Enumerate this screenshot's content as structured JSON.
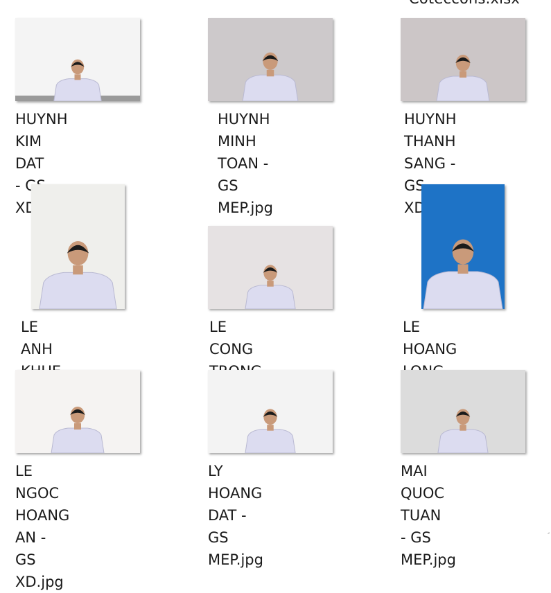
{
  "partial_item": {
    "label": "Coteccons.xlsx"
  },
  "files": [
    {
      "name": "HUYNH KIM DAT\n- GS XD.jpg",
      "photo": {
        "bg": "#f4f4f4",
        "scale": 0.9
      }
    },
    {
      "name": "HUYNH MINH\nTOAN - GS\nMEP.jpg",
      "photo": {
        "bg": "#cdc9cb",
        "scale": 1.05
      }
    },
    {
      "name": "HUYNH THANH\nSANG - GS\nXD.jpg",
      "photo": {
        "bg": "#ccc6c7",
        "scale": 1.0
      }
    },
    {
      "name": "LE ANH KHUE -\nGS XD.jpg",
      "photo": {
        "bg": "#efefec",
        "scale": 1.3
      }
    },
    {
      "name": "LE CONG TRONG\n- GS XD.jpg",
      "photo": {
        "bg": "#e6e2e3",
        "scale": 0.95
      }
    },
    {
      "name": "LE HOANG LONG\n- GS MEP.jpg",
      "photo": {
        "bg": "#1e73c6",
        "scale": 1.5
      }
    },
    {
      "name": "LE NGOC\nHOANG AN - GS\nXD.jpg",
      "photo": {
        "bg": "#f5f3f2",
        "scale": 1.0
      }
    },
    {
      "name": "LY HOANG DAT -\nGS MEP.jpg",
      "photo": {
        "bg": "#f3f3f3",
        "scale": 0.95
      }
    },
    {
      "name": "MAI QUOC TUAN\n- GS MEP.jpg",
      "photo": {
        "bg": "#dcdcdc",
        "scale": 0.95
      }
    }
  ]
}
